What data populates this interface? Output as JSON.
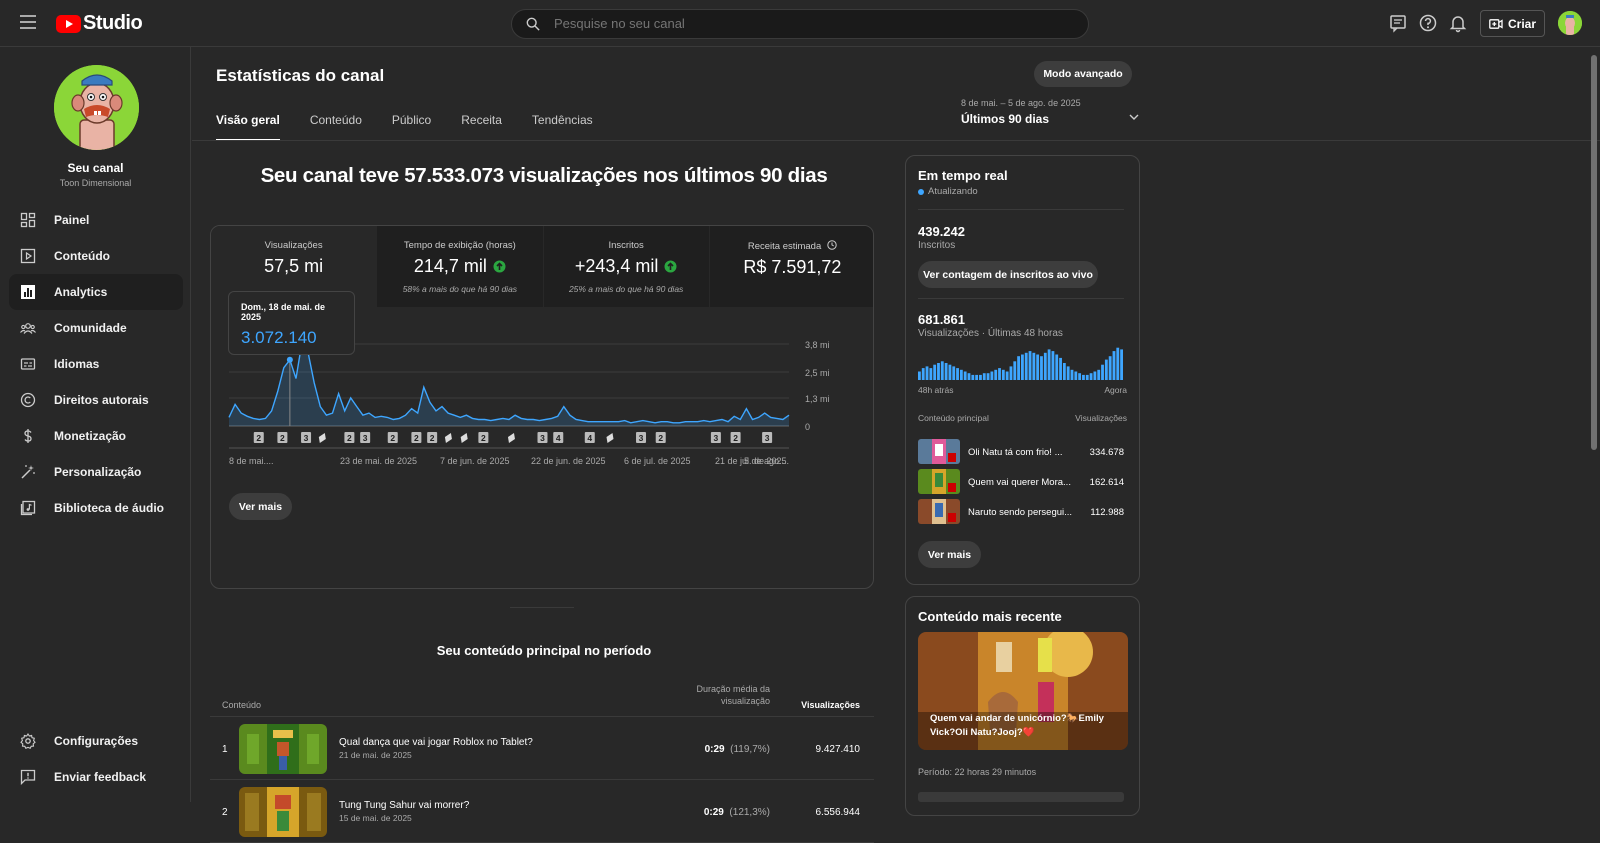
{
  "header": {
    "logo_text": "Studio",
    "search_placeholder": "Pesquise no seu canal",
    "create_label": "Criar",
    "icons": [
      "subtitles-icon",
      "help-icon",
      "bell-icon",
      "create-icon"
    ]
  },
  "sidebar": {
    "channel_name": "Seu canal",
    "channel_handle": "Toon Dimensional",
    "items": [
      {
        "label": "Painel",
        "icon": "dashboard-icon"
      },
      {
        "label": "Conteúdo",
        "icon": "content-icon"
      },
      {
        "label": "Analytics",
        "icon": "analytics-icon",
        "active": true
      },
      {
        "label": "Comunidade",
        "icon": "community-icon"
      },
      {
        "label": "Idiomas",
        "icon": "subtitles-icon"
      },
      {
        "label": "Direitos autorais",
        "icon": "copyright-icon"
      },
      {
        "label": "Monetização",
        "icon": "dollar-icon"
      },
      {
        "label": "Personalização",
        "icon": "magic-wand-icon"
      },
      {
        "label": "Biblioteca de áudio",
        "icon": "audio-library-icon"
      }
    ],
    "bottom_items": [
      {
        "label": "Configurações",
        "icon": "gear-icon"
      },
      {
        "label": "Enviar feedback",
        "icon": "feedback-icon"
      }
    ]
  },
  "page": {
    "title": "Estatísticas do canal",
    "advanced_mode": "Modo avançado",
    "tabs": [
      "Visão geral",
      "Conteúdo",
      "Público",
      "Receita",
      "Tendências"
    ],
    "date_range_small": "8 de mai. – 5 de ago. de 2025",
    "date_range": "Últimos 90 dias",
    "headline": "Seu canal teve 57.533.073 visualizações nos últimos 90 dias"
  },
  "kpis": [
    {
      "label": "Visualizações",
      "value": "57,5 mi",
      "sub": ""
    },
    {
      "label": "Tempo de exibição (horas)",
      "value": "214,7 mil",
      "sub": "58% a mais do que há 90 dias"
    },
    {
      "label": "Inscritos",
      "value": "+243,4 mil",
      "sub": "25% a mais do que há 90 dias"
    },
    {
      "label": "Receita estimada",
      "value": "R$ 7.591,72",
      "sub": ""
    }
  ],
  "tooltip": {
    "date": "Dom., 18 de mai. de 2025",
    "value": "3.072.140"
  },
  "chart_data": {
    "type": "area",
    "ylabel": "",
    "ylim": [
      0,
      3.8
    ],
    "y_ticks": [
      "3,8 mi",
      "2,5 mi",
      "1,3 mi",
      "0"
    ],
    "y_tick_values": [
      3.8,
      2.5,
      1.3,
      0
    ],
    "x_tick_labels": [
      "8 de mai....",
      "23 de mai. de 2025",
      "7 de jun. de 2025",
      "22 de jun. de 2025",
      "6 de jul. de 2025",
      "21 de jul. de 2025",
      "5 de ago...."
    ],
    "series": [
      {
        "values": [
          0.4,
          1.0,
          0.6,
          0.45,
          0.35,
          0.3,
          0.35,
          0.7,
          1.6,
          2.7,
          3.07,
          2.2,
          4.0,
          3.4,
          2.0,
          0.9,
          0.5,
          0.6,
          1.5,
          0.7,
          1.3,
          0.9,
          0.5,
          0.6,
          0.4,
          0.45,
          0.4,
          0.3,
          0.35,
          0.5,
          0.8,
          0.6,
          1.8,
          1.1,
          0.7,
          0.9,
          0.6,
          0.5,
          0.4,
          0.5,
          0.35,
          0.3,
          0.3,
          0.25,
          0.3,
          0.35,
          0.3,
          0.5,
          0.35,
          0.3,
          0.3,
          0.25,
          0.3,
          0.35,
          0.45,
          0.9,
          0.5,
          0.3,
          0.25,
          0.2,
          0.2,
          0.2,
          0.2,
          0.2,
          0.2,
          0.25,
          0.15,
          0.2,
          0.25,
          0.2,
          0.15,
          0.2,
          0.2,
          0.15,
          0.15,
          0.2,
          0.2,
          0.2,
          0.25,
          0.2,
          0.25,
          0.3,
          0.2,
          0.45,
          0.3,
          0.8,
          0.3,
          0.4,
          0.6,
          0.4,
          0.35,
          0.3,
          0.5
        ]
      }
    ],
    "markers": [
      {
        "i": 4,
        "label": "2"
      },
      {
        "i": 10,
        "label": "2"
      },
      {
        "i": 16,
        "label": "3"
      },
      {
        "i": 20,
        "label": "short"
      },
      {
        "i": 27,
        "label": "2"
      },
      {
        "i": 31,
        "label": "3"
      },
      {
        "i": 38,
        "label": "2"
      },
      {
        "i": 44,
        "label": "2"
      },
      {
        "i": 48,
        "label": "2"
      },
      {
        "i": 52,
        "label": "short"
      },
      {
        "i": 56,
        "label": "short"
      },
      {
        "i": 61,
        "label": "2"
      },
      {
        "i": 68,
        "label": "short"
      },
      {
        "i": 76,
        "label": "3"
      },
      {
        "i": 80,
        "label": "4"
      },
      {
        "i": 88,
        "label": "4"
      },
      {
        "i": 93,
        "label": "short"
      },
      {
        "i": 101,
        "label": "3"
      },
      {
        "i": 106,
        "label": "2"
      },
      {
        "i": 120,
        "label": "3"
      },
      {
        "i": 125,
        "label": "2"
      },
      {
        "i": 133,
        "label": "3"
      }
    ],
    "highlight_index": 10,
    "grid": true
  },
  "ver_mais": "Ver mais",
  "top_content": {
    "title": "Seu conteúdo principal no período",
    "col_content": "Conteúdo",
    "col_duration": "Duração média da visualização",
    "col_views": "Visualizações",
    "rows": [
      {
        "rank": "1",
        "title": "Qual dança que vai jogar Roblox no Tablet?",
        "date": "21 de mai. de 2025",
        "duration": "0:29",
        "pct": "(119,7%)",
        "views": "9.427.410"
      },
      {
        "rank": "2",
        "title": "Tung Tung Sahur vai morrer?",
        "date": "15 de mai. de 2025",
        "duration": "0:29",
        "pct": "(121,3%)",
        "views": "6.556.944"
      }
    ]
  },
  "realtime": {
    "title": "Em tempo real",
    "status": "Atualizando",
    "subs_value": "439.242",
    "subs_label": "Inscritos",
    "live_subs_button": "Ver contagem de inscritos ao vivo",
    "views_value": "681.861",
    "views_label": "Visualizações · Últimas 48 horas",
    "axis_start": "48h atrás",
    "axis_end": "Agora",
    "bars": [
      0.25,
      0.35,
      0.4,
      0.35,
      0.45,
      0.5,
      0.55,
      0.5,
      0.45,
      0.4,
      0.35,
      0.3,
      0.25,
      0.2,
      0.15,
      0.15,
      0.15,
      0.2,
      0.2,
      0.25,
      0.3,
      0.35,
      0.3,
      0.25,
      0.4,
      0.55,
      0.7,
      0.75,
      0.8,
      0.85,
      0.8,
      0.75,
      0.7,
      0.8,
      0.9,
      0.85,
      0.75,
      0.65,
      0.5,
      0.4,
      0.3,
      0.25,
      0.2,
      0.15,
      0.15,
      0.2,
      0.25,
      0.3,
      0.45,
      0.6,
      0.7,
      0.85,
      0.95,
      0.9
    ],
    "main_content_label": "Conteúdo principal",
    "views_col_label": "Visualizações",
    "items": [
      {
        "title": "Oli Natu tá com frio! ...",
        "views": "334.678"
      },
      {
        "title": "Quem vai querer Mora...",
        "views": "162.614"
      },
      {
        "title": "Naruto sendo persegui...",
        "views": "112.988"
      }
    ]
  },
  "latest": {
    "title": "Conteúdo mais recente",
    "caption": "Quem vai andar de unicórnio?🐎Emily Vick?Oli Natu?Jooj?❤️",
    "period": "Período: 22 horas 29 minutos"
  },
  "colors": {
    "accent": "#3ea6ff",
    "brand": "#ff0000",
    "positive": "#2ba640"
  }
}
